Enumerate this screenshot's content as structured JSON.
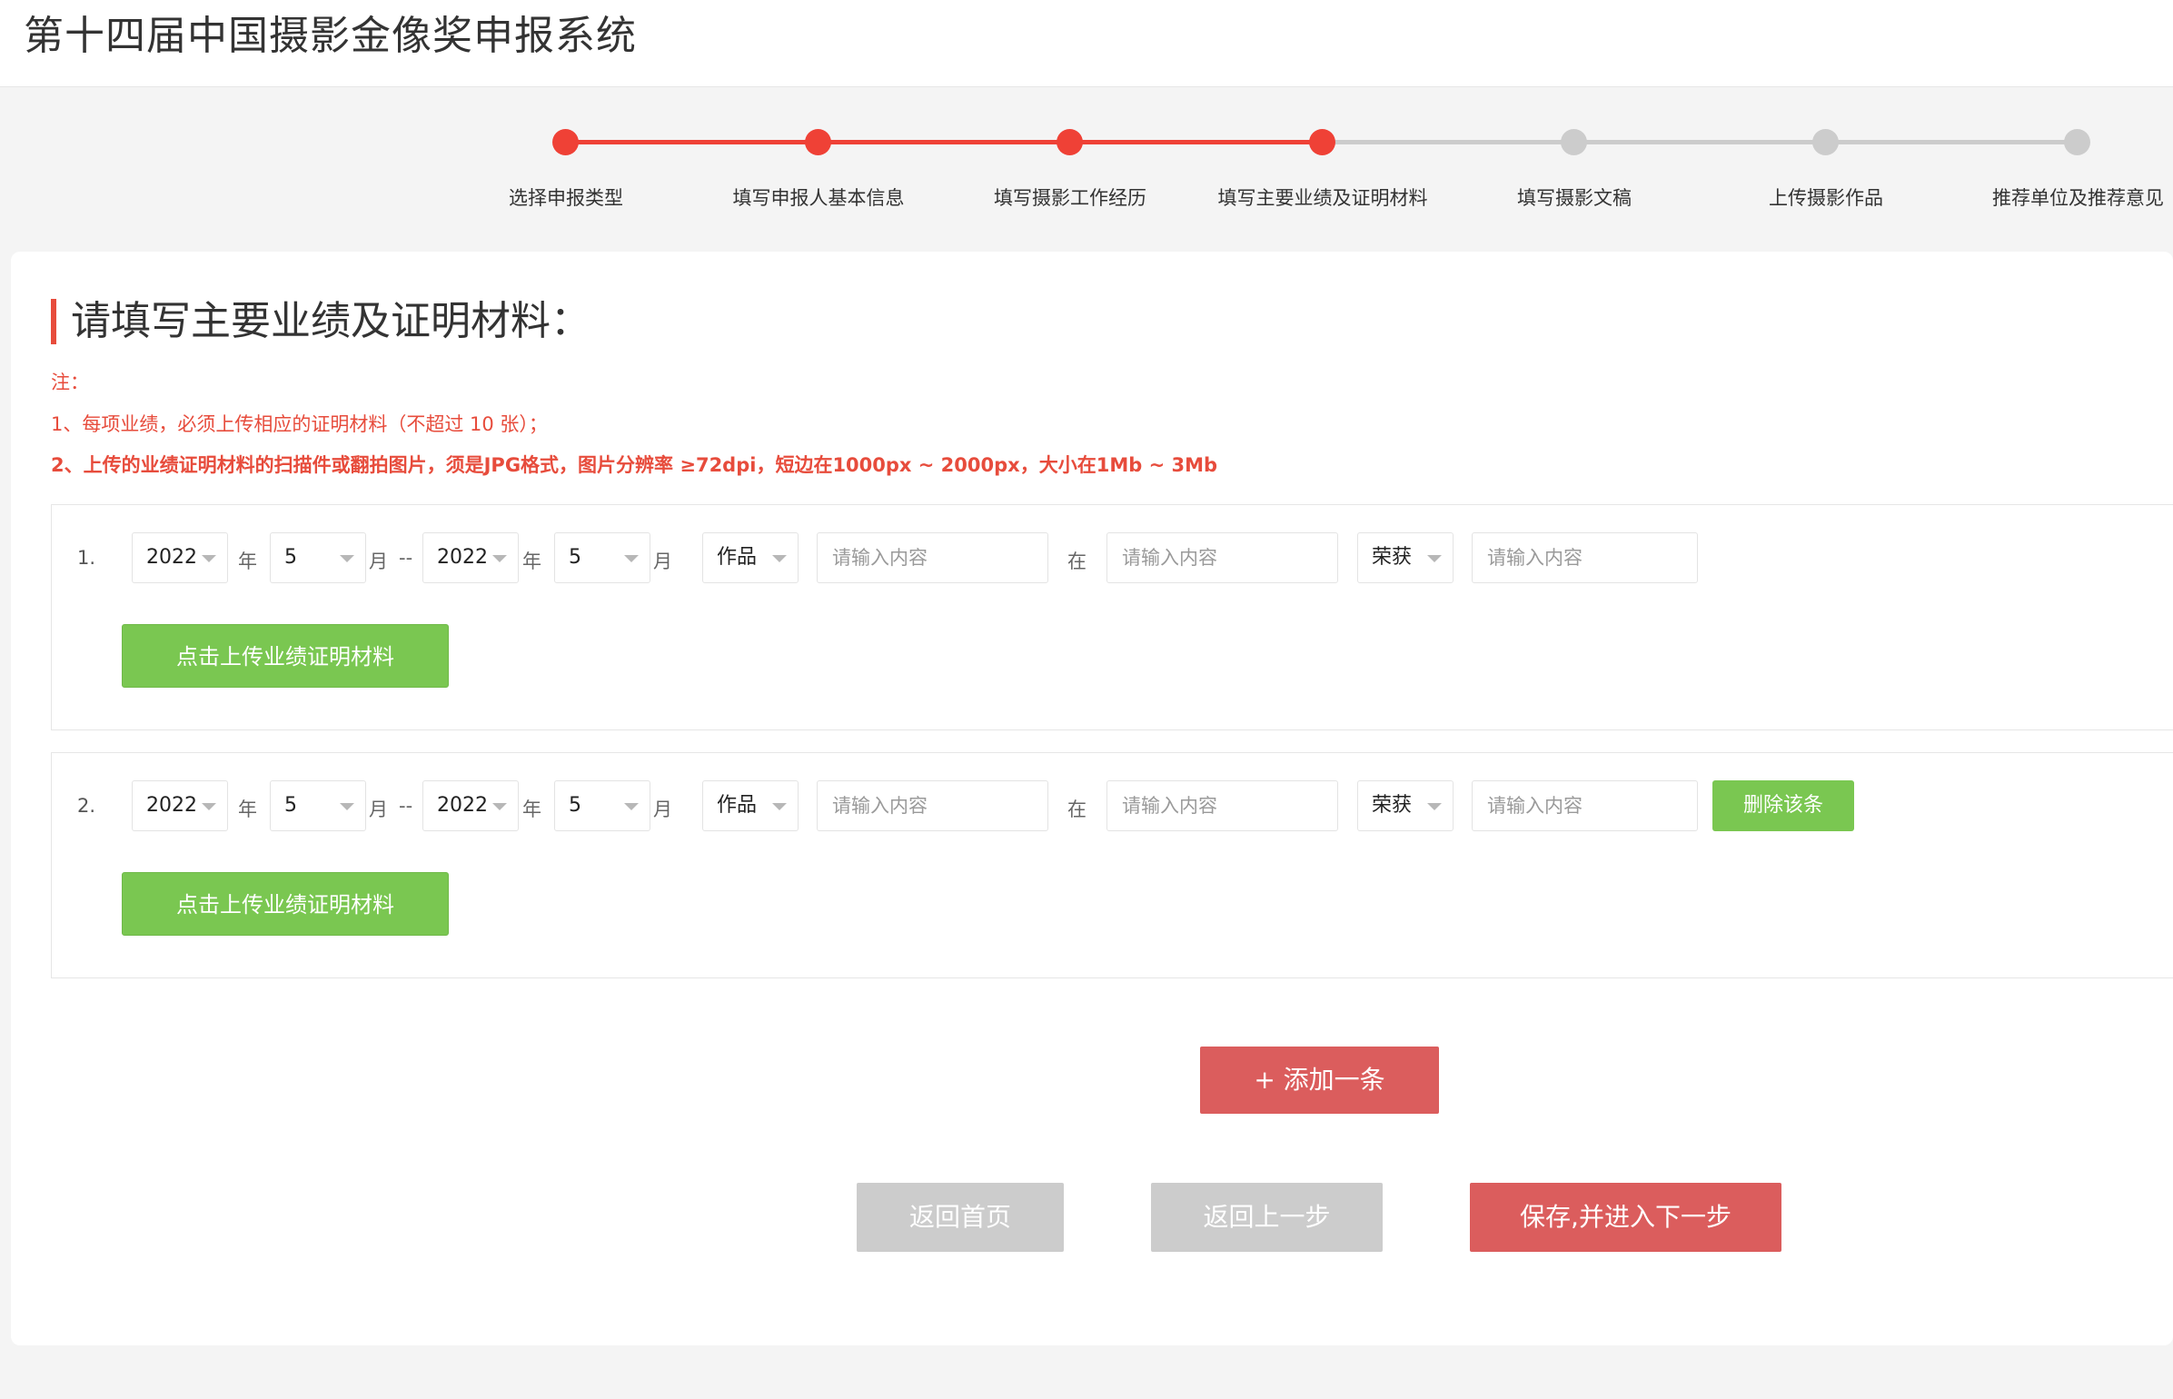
{
  "header": {
    "title": "第十四届中国摄影金像奖申报系统"
  },
  "steps": {
    "current_index": 3,
    "items": [
      {
        "label": "选择申报类型"
      },
      {
        "label": "填写申报人基本信息"
      },
      {
        "label": "填写摄影工作经历"
      },
      {
        "label": "填写主要业绩及证明材料"
      },
      {
        "label": "填写摄影文稿"
      },
      {
        "label": "上传摄影作品"
      },
      {
        "label": "推荐单位及推荐意见"
      }
    ]
  },
  "colors": {
    "accent": "#ef4136",
    "upload_green": "#7ac751",
    "button_red": "#db5d5d",
    "button_grey": "#cccccc"
  },
  "section": {
    "title": "请填写主要业绩及证明材料：",
    "note_label": "注：",
    "note_1": "1、每项业绩，必须上传相应的证明材料（不超过 10 张）；",
    "note_2": "2、上传的业绩证明材料的扫描件或翻拍图片，须是JPG格式，图片分辨率 ≥72dpi，短边在1000px ~ 2000px，大小在1Mb ~ 3Mb"
  },
  "labels": {
    "year": "年",
    "month": "月",
    "dash": "--",
    "at": "在"
  },
  "entries": [
    {
      "index": "1.",
      "start_year": "2022",
      "start_month": "5",
      "end_year": "2022",
      "end_month": "5",
      "type": "作品",
      "content_placeholder": "请输入内容",
      "place_placeholder": "请输入内容",
      "award": "荣获",
      "award_placeholder": "请输入内容",
      "upload_label": "点击上传业绩证明材料"
    },
    {
      "index": "2.",
      "start_year": "2022",
      "start_month": "5",
      "end_year": "2022",
      "end_month": "5",
      "type": "作品",
      "content_placeholder": "请输入内容",
      "place_placeholder": "请输入内容",
      "award": "荣获",
      "award_placeholder": "请输入内容",
      "upload_label": "点击上传业绩证明材料",
      "delete_label": "删除该条"
    }
  ],
  "actions": {
    "add_label": "+ 添加一条",
    "home_label": "返回首页",
    "prev_label": "返回上一步",
    "next_label": "保存,并进入下一步"
  }
}
